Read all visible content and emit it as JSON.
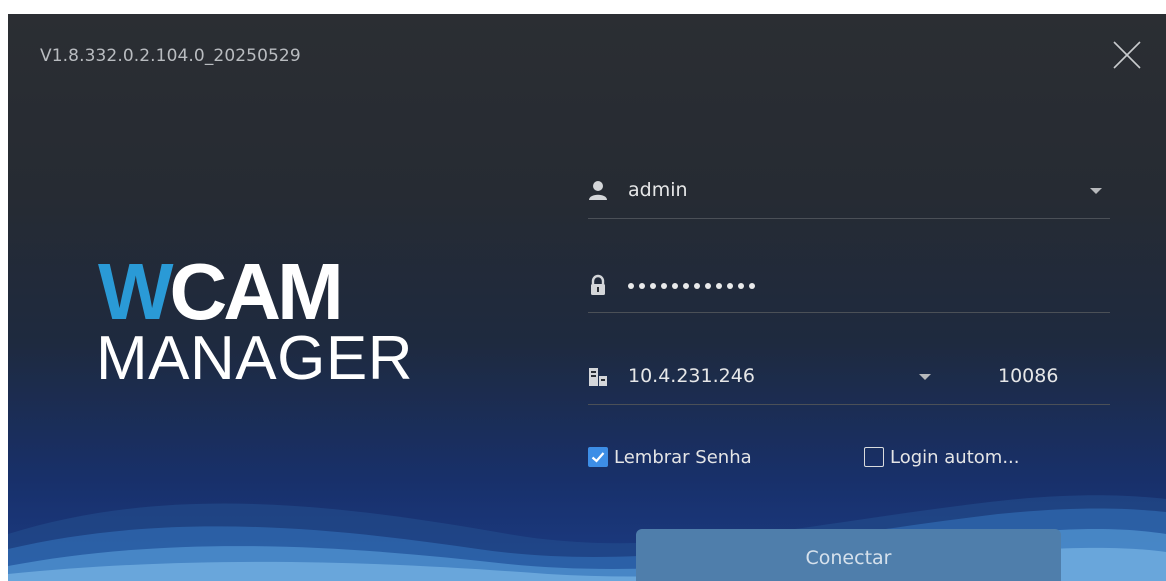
{
  "window": {
    "version": "V1.8.332.0.2.104.0_20250529"
  },
  "logo": {
    "w_letter": "W",
    "rest": "CAM",
    "bottom": "MANAGER"
  },
  "login": {
    "username": "admin",
    "password_dot_count": 12,
    "server_ip": "10.4.231.246",
    "port": "10086"
  },
  "options": {
    "remember_label": "Lembrar Senha",
    "remember_checked": true,
    "auto_login_label": "Login autom...",
    "auto_login_checked": false
  },
  "buttons": {
    "connect_label": "Conectar"
  },
  "colors": {
    "accent": "#3d8ee6",
    "logo_blue": "#2a9ad6",
    "button": "#4f7eab"
  },
  "icons": {
    "close": "close-icon",
    "user": "user-icon",
    "lock": "lock-icon",
    "server": "server-icon",
    "dropdown": "chevron-down-icon",
    "check": "check-icon"
  }
}
